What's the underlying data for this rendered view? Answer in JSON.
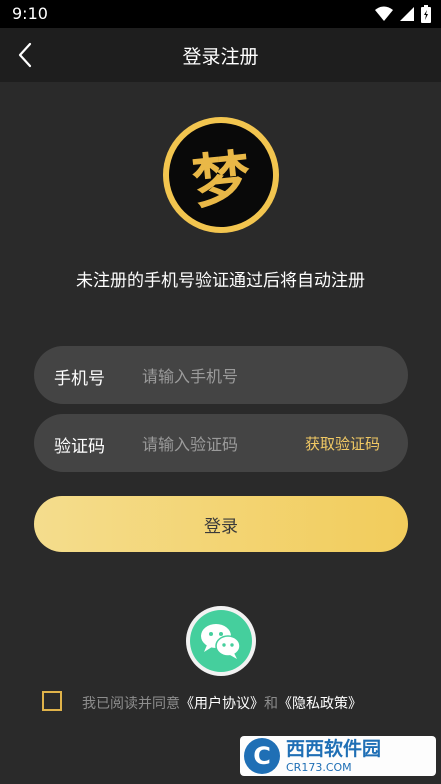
{
  "status_bar": {
    "time": "9:10"
  },
  "nav": {
    "title": "登录注册"
  },
  "logo": {
    "glyph": "梦"
  },
  "subtitle": "未注册的手机号验证通过后将自动注册",
  "phone_field": {
    "label": "手机号",
    "placeholder": "请输入手机号",
    "value": ""
  },
  "code_field": {
    "label": "验证码",
    "placeholder": "请输入验证码",
    "value": "",
    "get_code_label": "获取验证码"
  },
  "login_button": {
    "label": "登录"
  },
  "agreement": {
    "prefix": "我已阅读并同意",
    "user_agreement": "《用户协议》",
    "conjunction": "和",
    "privacy_policy": "《隐私政策》",
    "checked": false
  },
  "watermark": {
    "title": "西西软件园",
    "url": "CR173.COM",
    "logo_letter": "C"
  },
  "colors": {
    "accent": "#f1c964",
    "background": "#2a2a2a",
    "field_bg": "#444444",
    "wechat": "#45cf9d"
  }
}
